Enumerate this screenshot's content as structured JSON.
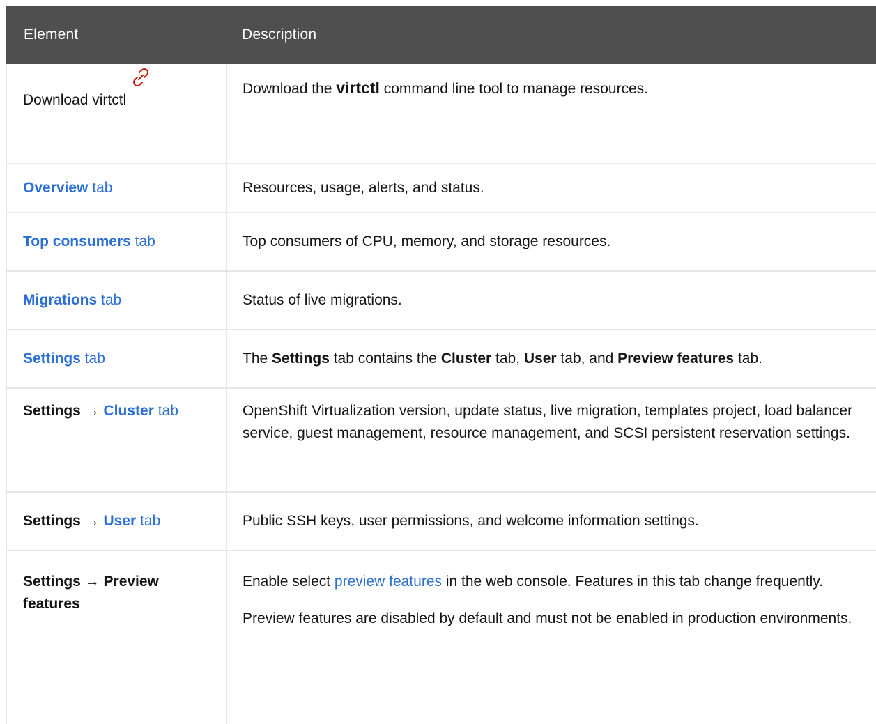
{
  "header": {
    "col_element": "Element",
    "col_description": "Description"
  },
  "rows": [
    {
      "element": "Download virtctl",
      "element_icon": "external-link-icon",
      "desc_pre": "Download the ",
      "desc_cmd": "virtctl",
      "desc_post": " command line tool to manage resources."
    },
    {
      "element_link": "Overview",
      "element_suffix": " tab",
      "desc": "Resources, usage, alerts, and status."
    },
    {
      "element_link": "Top consumers",
      "element_suffix": " tab",
      "desc": "Top consumers of CPU, memory, and storage resources."
    },
    {
      "element_link": "Migrations",
      "element_suffix": " tab",
      "desc": "Status of live migrations."
    },
    {
      "element_link": "Settings",
      "element_suffix": " tab",
      "desc_1": "The ",
      "desc_2": "Settings",
      "desc_3": " tab contains the ",
      "desc_4": "Cluster",
      "desc_5": " tab, ",
      "desc_6": "User",
      "desc_7": " tab, and ",
      "desc_8": "Preview features",
      "desc_9": " tab."
    },
    {
      "element_prefix": "Settings → ",
      "element_link": "Cluster",
      "element_suffix": " tab",
      "desc": "OpenShift Virtualization version, update status, live migration, templates project, load balancer service, guest management, resource management, and SCSI persistent reservation settings."
    },
    {
      "element_prefix": "Settings → ",
      "element_link": "User",
      "element_suffix": " tab",
      "desc": "Public SSH keys, user permissions, and welcome information settings."
    },
    {
      "element": "Settings → Preview features",
      "desc_p1_pre": "Enable select ",
      "desc_p1_link": "preview features",
      "desc_p1_post": " in the web console. Features in this tab change frequently.",
      "desc_p2": "Preview features are disabled by default and must not be enabled in production environments."
    }
  ],
  "colors": {
    "header_bg": "#4f4f4f",
    "link": "#2b6fd3",
    "icon": "#c9190b",
    "border": "#e6e6e6"
  }
}
